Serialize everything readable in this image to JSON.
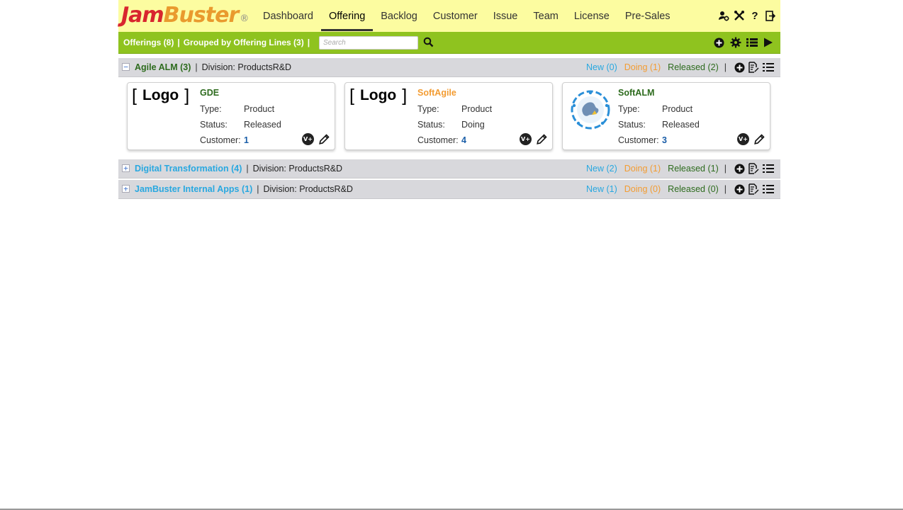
{
  "header": {
    "logo": {
      "part1": "Jam",
      "part2": "Buster",
      "reg": "®"
    },
    "nav": [
      {
        "label": "Dashboard",
        "active": false
      },
      {
        "label": "Offering",
        "active": true
      },
      {
        "label": "Backlog",
        "active": false
      },
      {
        "label": "Customer",
        "active": false
      },
      {
        "label": "Issue",
        "active": false
      },
      {
        "label": "Team",
        "active": false
      },
      {
        "label": "License",
        "active": false
      },
      {
        "label": "Pre-Sales",
        "active": false
      }
    ],
    "icons": [
      "user-settings-icon",
      "tools-icon",
      "help-icon",
      "logout-icon"
    ]
  },
  "toolbar": {
    "offerings": "Offerings (8)",
    "grouped": "Grouped by Offering Lines (3)",
    "sep": "|",
    "search_placeholder": "Search",
    "icons": [
      "add-icon",
      "settings-icon",
      "list-view-icon",
      "play-icon"
    ]
  },
  "groups": [
    {
      "name": "Agile ALM (3)",
      "division": "Division: ProductsR&D",
      "toggle": "−",
      "expanded": true,
      "new": "New (0)",
      "doing": "Doing (1)",
      "released": "Released (2)",
      "cards": [
        {
          "logo_text": "Logo",
          "name": "GDE",
          "status_color": "released",
          "type_label": "Type:",
          "type": "Product",
          "status_label": "Status:",
          "status": "Released",
          "customer_label": "Customer:",
          "customer": "1",
          "vplus": "V+"
        },
        {
          "logo_text": "Logo",
          "name": "SoftAgile",
          "status_color": "doing",
          "type_label": "Type:",
          "type": "Product",
          "status_label": "Status:",
          "status": "Doing",
          "customer_label": "Customer:",
          "customer": "4",
          "vplus": "V+"
        },
        {
          "logo_text": "",
          "name": "SoftALM",
          "status_color": "released",
          "type_label": "Type:",
          "type": "Product",
          "status_label": "Status:",
          "status": "Released",
          "customer_label": "Customer:",
          "customer": "3",
          "vplus": "V+"
        }
      ]
    },
    {
      "name": "Digital Transformation (4)",
      "division": "Division: ProductsR&D",
      "toggle": "+",
      "expanded": false,
      "new": "New (2)",
      "doing": "Doing (1)",
      "released": "Released (1)"
    },
    {
      "name": "JamBuster Internal Apps (1)",
      "division": "Division: ProductsR&D",
      "toggle": "+",
      "expanded": false,
      "new": "New (1)",
      "doing": "Doing (0)",
      "released": "Released (0)"
    }
  ],
  "colors": {
    "header_bg": "#fcfca0",
    "toolbar_bg": "#8fc31f",
    "group_bg": "#d8d8dc",
    "new": "#29a8e0",
    "doing": "#f39c32",
    "released": "#2d6b1d"
  }
}
